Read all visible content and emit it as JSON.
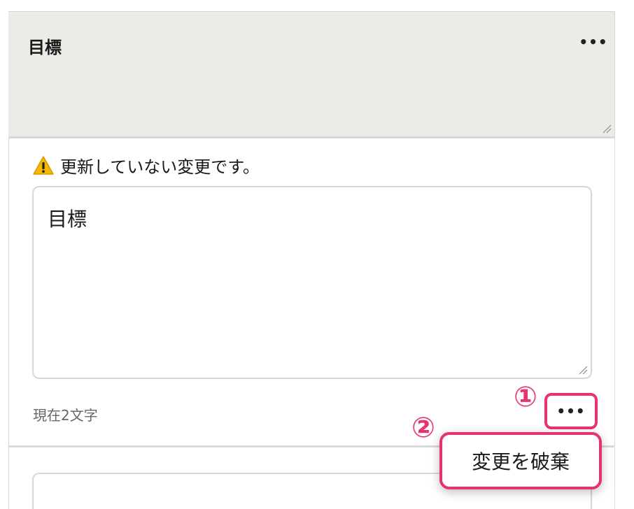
{
  "header": {
    "title": "目標",
    "menu_label": "•••"
  },
  "warning": {
    "icon": "warning-icon",
    "text": "更新していない変更です。"
  },
  "editor": {
    "value": "目標",
    "char_count": "現在2文字"
  },
  "more_button": {
    "label": "•••"
  },
  "annotations": {
    "step1": "①",
    "step2": "②"
  },
  "popup": {
    "discard_label": "変更を破棄"
  },
  "colors": {
    "accent": "#e8336f",
    "header_bg": "#ecebe8",
    "warning": "#f5b800"
  }
}
